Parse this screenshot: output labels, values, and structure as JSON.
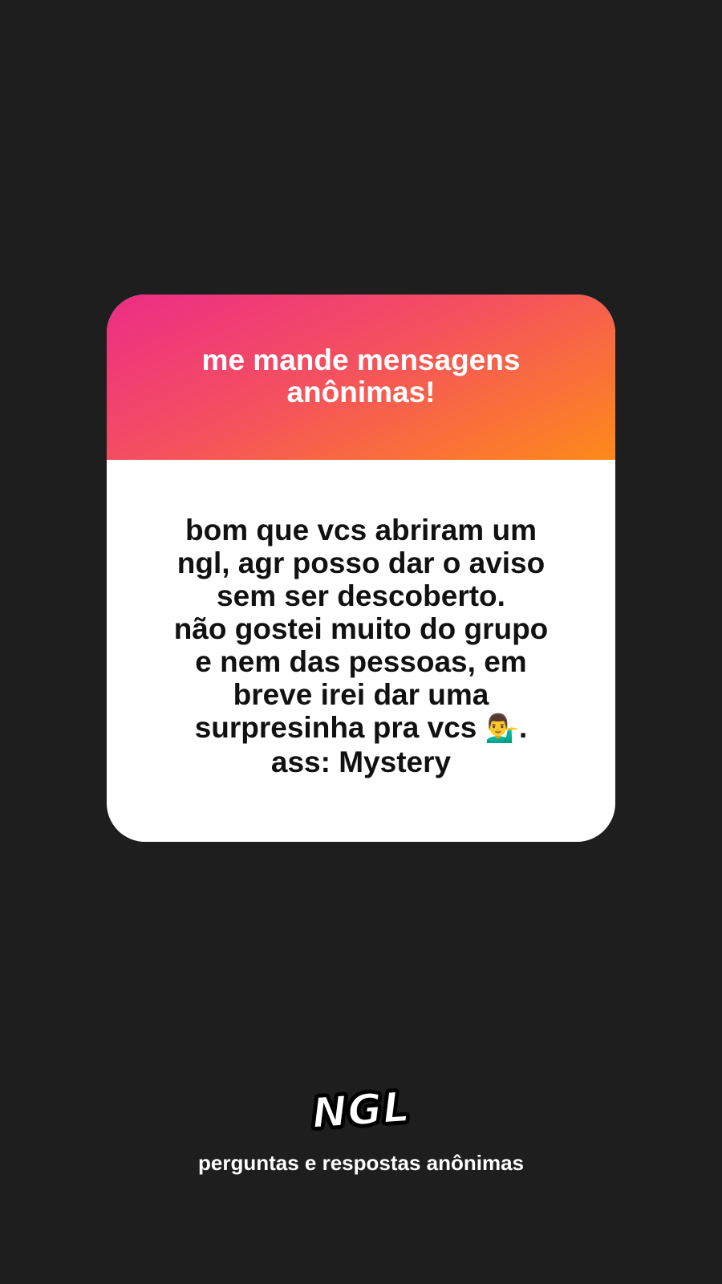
{
  "card": {
    "prompt": "me mande mensagens anônimas!",
    "message_lines": [
      "bom que vcs abriram um",
      "ngl, agr posso dar o aviso",
      "sem ser descoberto.",
      "não gostei muito do grupo",
      "e nem das pessoas, em",
      "breve irei dar uma",
      "surpresinha pra vcs",
      "ass: Mystery"
    ],
    "message_emoji": "💁‍♂️",
    "message_emoji_suffix": "."
  },
  "footer": {
    "logo": "NGL",
    "tagline": "perguntas e respostas anônimas"
  },
  "colors": {
    "background": "#1e1e1e",
    "gradient_start": "#ec2d86",
    "gradient_end": "#fd8a1a",
    "card_body": "#ffffff"
  }
}
